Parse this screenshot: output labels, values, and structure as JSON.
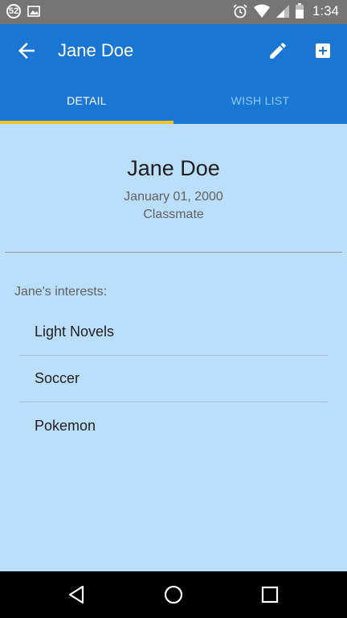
{
  "status_bar": {
    "notification_count": "52",
    "time": "1:34"
  },
  "app_bar": {
    "title": "Jane Doe",
    "icons": {
      "back": "arrow-back-icon",
      "edit": "pencil-icon",
      "add": "add-box-icon"
    }
  },
  "tabs": [
    {
      "label": "DETAIL",
      "active": true
    },
    {
      "label": "WISH LIST",
      "active": false
    }
  ],
  "profile": {
    "name": "Jane Doe",
    "birthday": "January 01, 2000",
    "relation": "Classmate",
    "interests_label": "Jane's interests:",
    "interests": [
      "Light Novels",
      "Soccer",
      "Pokemon"
    ]
  },
  "colors": {
    "app_bar": "#1976d2",
    "background": "#bbdefb",
    "tab_indicator": "#fbc02d"
  }
}
